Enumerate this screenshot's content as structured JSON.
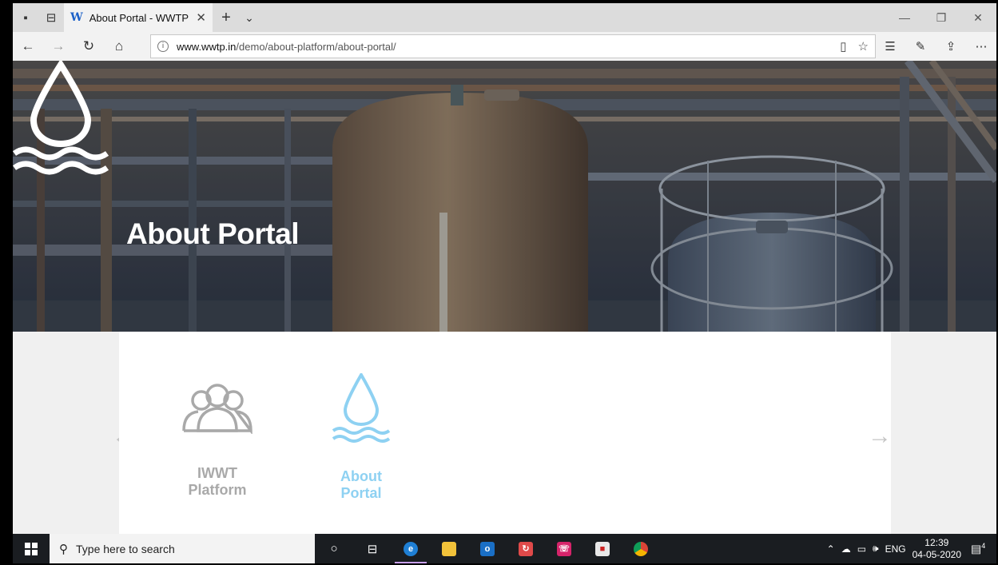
{
  "browser": {
    "tab": {
      "title": "About Portal - WWTP",
      "favicon": "W"
    },
    "address": {
      "url_host": "www.wwtp.in",
      "url_path": "/demo/about-platform/about-portal/"
    }
  },
  "hero": {
    "title": "About Portal"
  },
  "slider": {
    "items": [
      {
        "line1": "IWWT",
        "line2": "Platform",
        "icon": "people-icon",
        "active": false
      },
      {
        "line1": "About",
        "line2": "Portal",
        "icon": "water-drop-icon",
        "active": true
      }
    ]
  },
  "taskbar": {
    "search_placeholder": "Type here to search",
    "lang": "ENG",
    "time": "12:39",
    "date": "04-05-2020",
    "notification_count": "4"
  },
  "colors": {
    "accent": "#8ed1f2",
    "inactive": "#a9a9a9"
  }
}
